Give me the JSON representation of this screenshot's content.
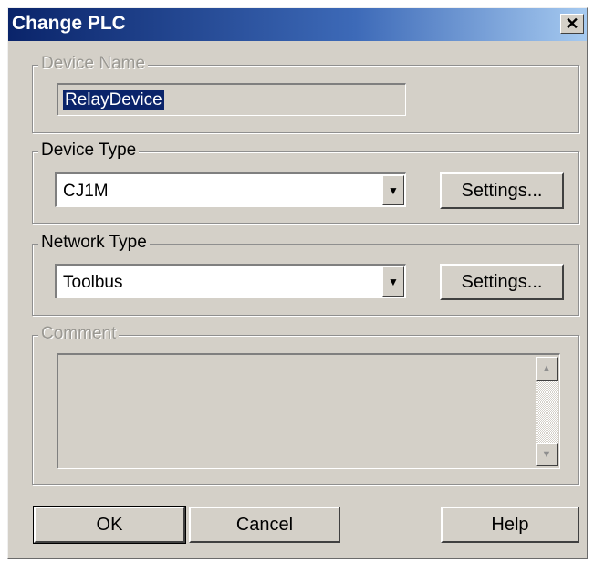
{
  "window": {
    "title": "Change PLC",
    "close_glyph": "✕"
  },
  "device_name": {
    "legend": "Device Name",
    "value": "RelayDevice"
  },
  "device_type": {
    "legend": "Device Type",
    "value": "CJ1M",
    "settings_label": "Settings..."
  },
  "network_type": {
    "legend": "Network Type",
    "value": "Toolbus",
    "settings_label": "Settings..."
  },
  "comment": {
    "legend": "Comment",
    "value": ""
  },
  "buttons": {
    "ok": "OK",
    "cancel": "Cancel",
    "help": "Help"
  },
  "icons": {
    "dropdown": "chevron-down-icon",
    "scroll_up": "scroll-up-icon",
    "scroll_down": "scroll-down-icon",
    "close": "close-icon"
  },
  "colors": {
    "title_start": "#0a246a",
    "title_end": "#a6caf0",
    "face": "#d4d0c8",
    "selection": "#0a246a"
  }
}
